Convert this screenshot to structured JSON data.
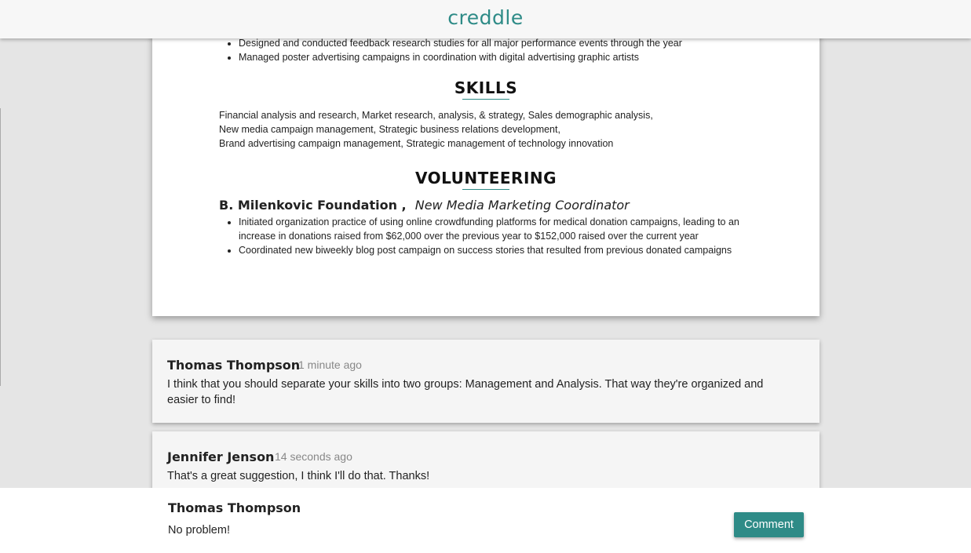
{
  "app": {
    "logo": "creddle"
  },
  "resume": {
    "experience_bullets": [
      "Designed and conducted feedback research studies for all major performance events through the year",
      "Managed poster advertising campaigns in coordination with digital advertising graphic artists"
    ],
    "skills": {
      "title": "SKILLS",
      "lines": [
        "Financial analysis and research, Market research, analysis, & strategy, Sales demographic analysis,",
        "New media campaign management, Strategic business relations development,",
        "Brand advertising campaign management, Strategic management of technology innovation"
      ]
    },
    "volunteering": {
      "title": "VOLUNTEERING",
      "organization": "B. Milenkovic Foundation ,",
      "role": "New Media Marketing Coordinator",
      "bullets": [
        "Initiated organization practice of using online crowdfunding platforms for medical donation campaigns, leading to an increase in donations raised from $62,000 over the previous year to $152,000 raised over the current year",
        "Coordinated new biweekly blog post campaign on success stories that resulted from previous donated campaigns"
      ]
    }
  },
  "comments": [
    {
      "author": "Thomas Thompson",
      "time": "1 minute ago",
      "text": "I think that you should separate your skills into two groups: Management and Analysis.  That way they're organized and easier to find!"
    },
    {
      "author": "Jennifer Jenson",
      "time": "14 seconds ago",
      "text": "That's a great suggestion, I think I'll do that.  Thanks!"
    }
  ],
  "composer": {
    "author": "Thomas Thompson",
    "value": "No problem!",
    "button_label": "Comment"
  },
  "colors": {
    "accent": "#2e8b87",
    "background": "#e5e5e5"
  }
}
